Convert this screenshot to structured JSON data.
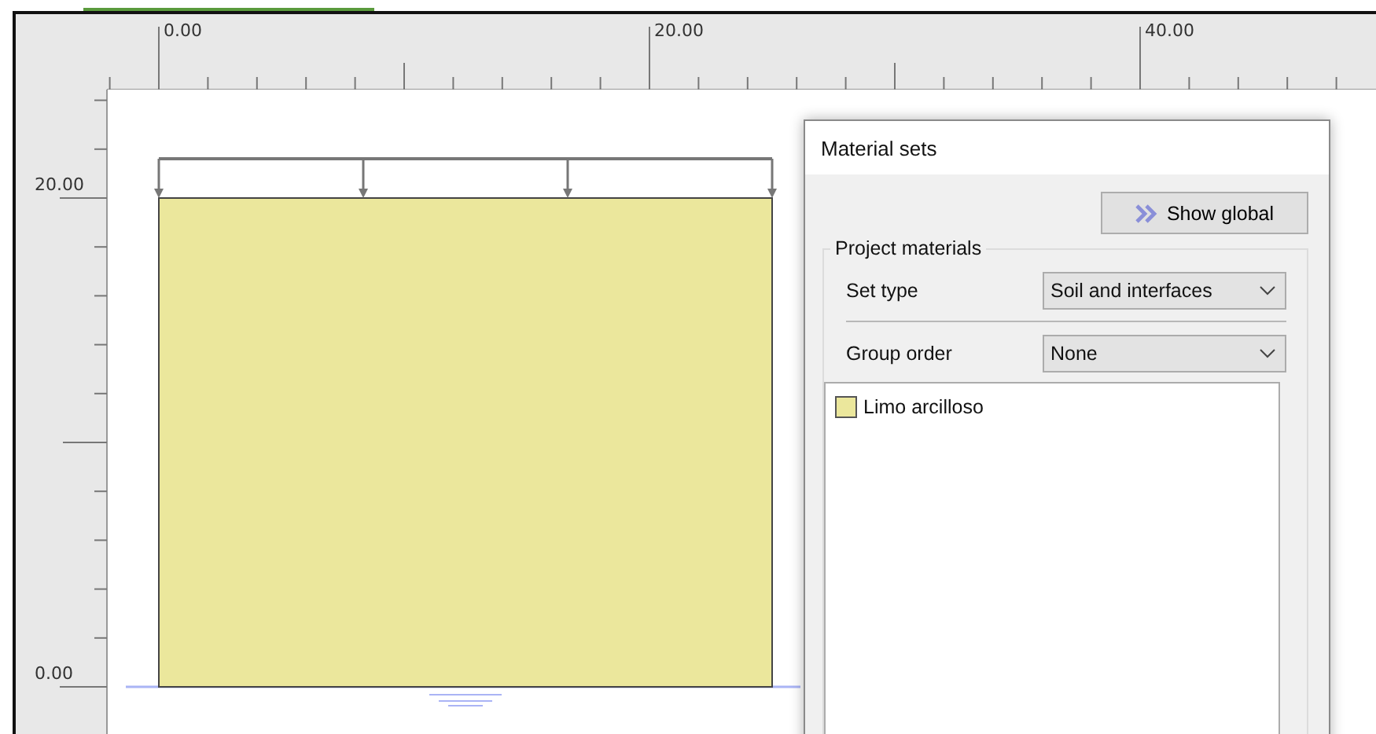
{
  "ruler_x": {
    "labels": [
      "0.00",
      "20.00",
      "40.00"
    ]
  },
  "ruler_y": {
    "labels": [
      "20.00",
      "0.00"
    ]
  },
  "dialog": {
    "title": "Material sets",
    "show_global_button": "Show global",
    "group_title": "Project materials",
    "fields": [
      {
        "label": "Set type",
        "value": "Soil and interfaces"
      },
      {
        "label": "Group order",
        "value": "None"
      }
    ],
    "materials": [
      {
        "name": "Limo arcilloso",
        "color": "#ebe79c",
        "selected": false
      }
    ]
  }
}
